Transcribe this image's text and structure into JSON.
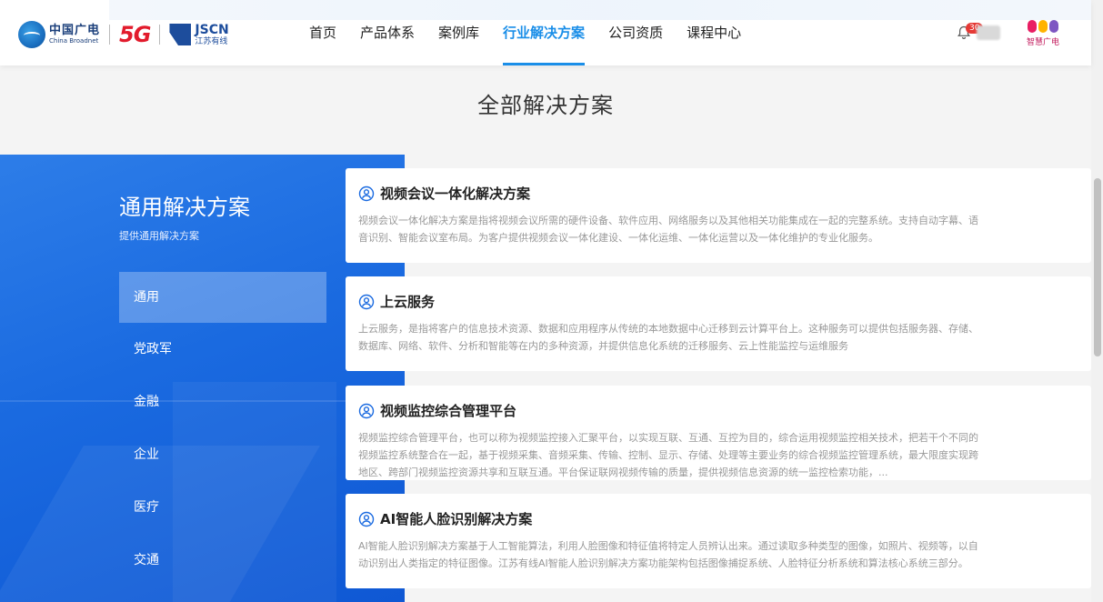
{
  "brand": {
    "cbn_cn": "中国广电",
    "cbn_en": "China Broadnet",
    "fiveg": "5G",
    "jscn_en": "JSCN",
    "jscn_cn": "江苏有线",
    "zh_text": "智慧广电"
  },
  "nav": {
    "items": [
      {
        "label": "首页"
      },
      {
        "label": "产品体系"
      },
      {
        "label": "案例库"
      },
      {
        "label": "行业解决方案"
      },
      {
        "label": "公司资质"
      },
      {
        "label": "课程中心"
      }
    ],
    "active": "行业解决方案"
  },
  "header": {
    "badge_count": "30"
  },
  "page": {
    "title": "全部解决方案"
  },
  "panel": {
    "title": "通用解决方案",
    "subtitle": "提供通用解决方案",
    "categories": [
      {
        "label": "通用"
      },
      {
        "label": "党政军"
      },
      {
        "label": "金融"
      },
      {
        "label": "企业"
      },
      {
        "label": "医疗"
      },
      {
        "label": "交通"
      }
    ]
  },
  "cards": [
    {
      "title": "视频会议一体化解决方案",
      "desc": "视频会议一体化解决方案是指将视频会议所需的硬件设备、软件应用、网络服务以及其他相关功能集成在一起的完整系统。支持自动字幕、语音识别、智能会议室布局。为客户提供视频会议一体化建设、一体化运维、一体化运营以及一体化维护的专业化服务。"
    },
    {
      "title": "上云服务",
      "desc": "上云服务，是指将客户的信息技术资源、数据和应用程序从传统的本地数据中心迁移到云计算平台上。这种服务可以提供包括服务器、存储、数据库、网络、软件、分析和智能等在内的多种资源，并提供信息化系统的迁移服务、云上性能监控与运维服务"
    },
    {
      "title": "视频监控综合管理平台",
      "desc": "视频监控综合管理平台，也可以称为视频监控接入汇聚平台，以实现互联、互通、互控为目的，综合运用视频监控相关技术，把若干个不同的视频监控系统整合在一起，基于视频采集、音频采集、传输、控制、显示、存储、处理等主要业务的综合视频监控管理系统，最大限度实现跨地区、跨部门视频监控资源共享和互联互通。平台保证联网视频传输的质量，提供视频信息资源的统一监控检索功能，..."
    },
    {
      "title": "AI智能人脸识别解决方案",
      "desc": "AI智能人脸识别解决方案基于人工智能算法，利用人脸图像和特征值将特定人员辨认出来。通过读取多种类型的图像，如照片、视频等，以自动识别出人类指定的特征图像。江苏有线AI智能人脸识别解决方案功能架构包括图像捕捉系统、人脸特征分析系统和算法核心系统三部分。"
    }
  ],
  "colors": {
    "accent": "#1a8ee8",
    "panel_blue": "#1a6ae0"
  }
}
